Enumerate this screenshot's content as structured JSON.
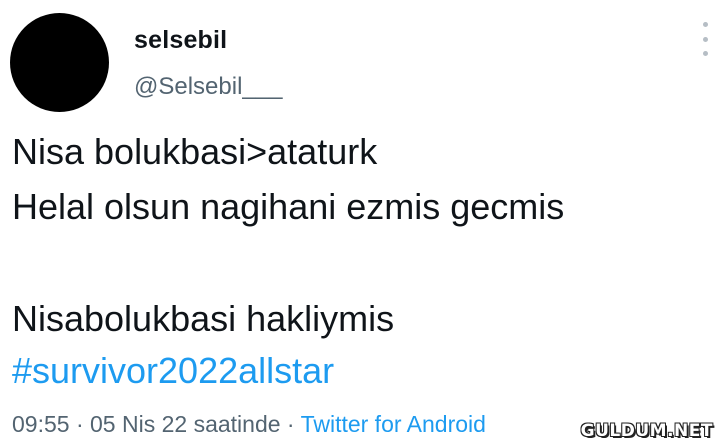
{
  "author": {
    "display_name": "selsebil",
    "handle": "@Selsebil___"
  },
  "tweet": {
    "lines": [
      "Nisa bolukbasi>ataturk",
      "Helal olsun nagihani ezmis gecmis",
      "",
      "Nisabolukbasi hakliymis"
    ],
    "hashtag": "#survivor2022allstar",
    "time": "09:55",
    "separator": " · ",
    "date": "05 Nis 22 saatinde",
    "source": "Twitter for Android"
  },
  "watermark": "GULDUM.NET",
  "icons": {
    "more": "more-vertical-icon"
  },
  "colors": {
    "text": "#0f1419",
    "secondary": "#536471",
    "link": "#1d9bf0",
    "avatar": "#000000"
  }
}
